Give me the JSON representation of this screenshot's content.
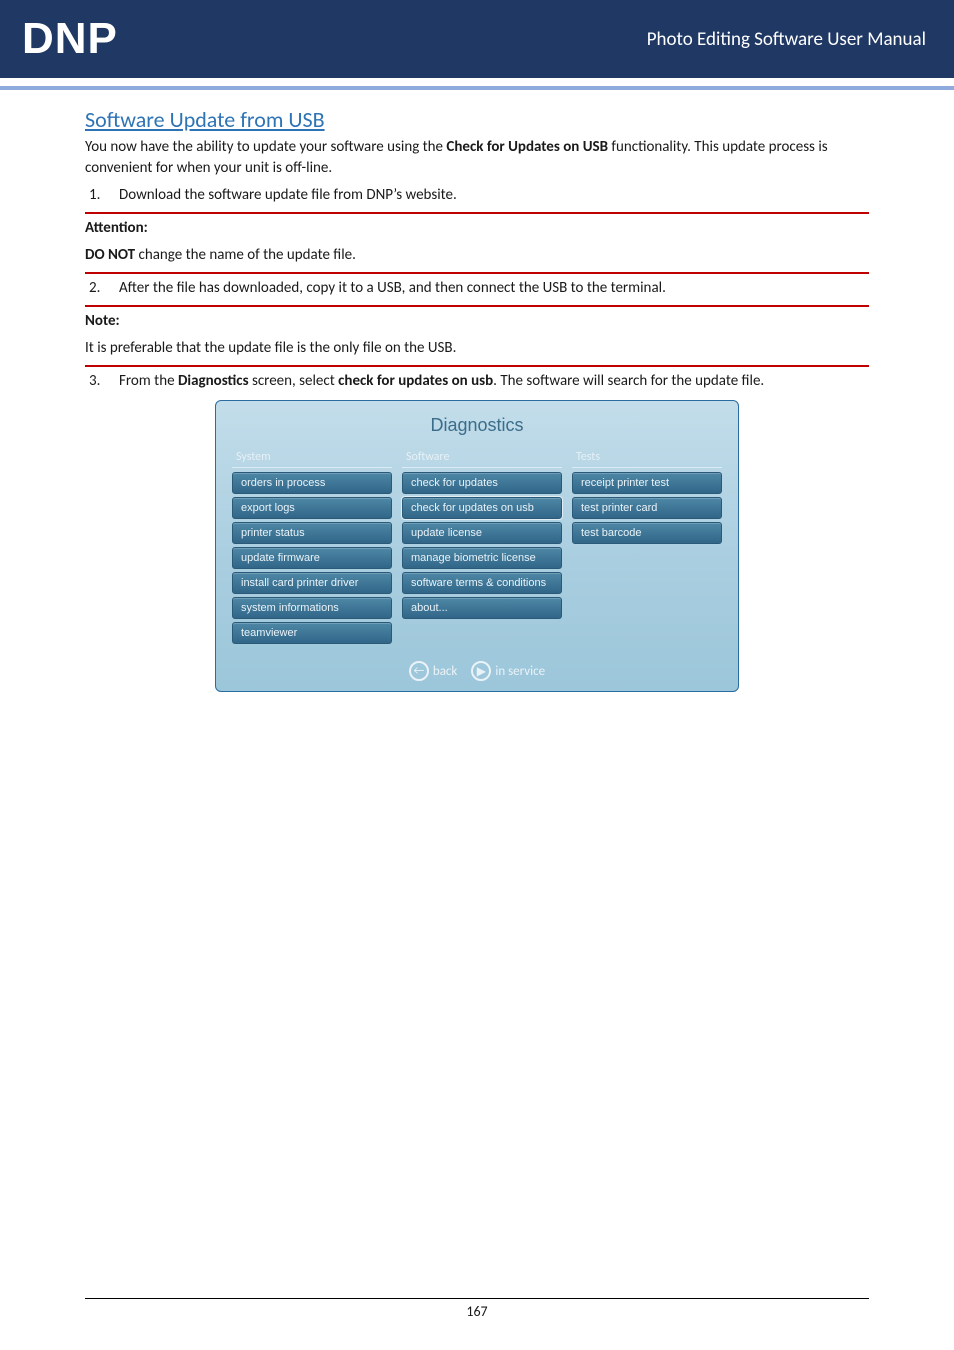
{
  "header": {
    "logo": "DNP",
    "title": "Photo Editing Software User Manual"
  },
  "section_title": "Software Update from USB",
  "intro": {
    "prefix": "You now have the ability to update your software using the ",
    "bold": "Check for Updates on USB",
    "suffix": " functionality. This update process is convenient for when your unit is off-line."
  },
  "steps": {
    "s1_num": "1.",
    "s1": "Download the software update file from DNP’s website.",
    "s2_num": "2.",
    "s2": "After the file has downloaded, copy it to a USB, and then connect the USB to the terminal.",
    "s3_num": "3.",
    "s3_prefix": "From the ",
    "s3_b1": "Diagnostics",
    "s3_mid": " screen, select ",
    "s3_b2": "check for updates on usb",
    "s3_suffix": ". The software will search for the update file."
  },
  "attention": {
    "label": "Attention:",
    "line_b": "DO NOT",
    "line_rest": " change the name of the update file."
  },
  "note": {
    "label": "Note:",
    "line": "It is preferable that the update file is the only file on the USB."
  },
  "screenshot": {
    "title": "Diagnostics",
    "cols": {
      "system": {
        "head": "System",
        "items": [
          "orders in process",
          "export logs",
          "printer status",
          "update firmware",
          "install card printer driver",
          "system informations",
          "teamviewer"
        ]
      },
      "software": {
        "head": "Software",
        "items": [
          "check for updates",
          "check for updates on usb",
          "update license",
          "manage biometric license",
          "software terms & conditions",
          "about..."
        ]
      },
      "tests": {
        "head": "Tests",
        "items": [
          "receipt printer test",
          "test printer card",
          "test barcode"
        ]
      }
    },
    "footer": {
      "back": "back",
      "in_service": "in service"
    }
  },
  "page_number": "167"
}
